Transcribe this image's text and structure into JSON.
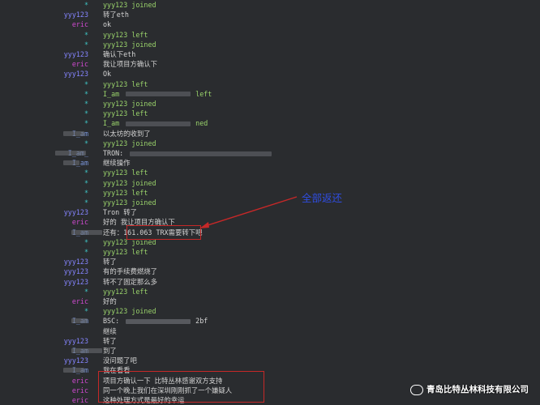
{
  "annotation": {
    "text": "全部返还"
  },
  "watermark": {
    "company": "青岛比特丛林科技有限公司",
    "icon": "wechat-icon"
  },
  "colors": {
    "background": "#2a2c2f",
    "highlight_box": "#c62828",
    "annotation": "#2f4de0"
  },
  "lines": [
    {
      "nick": "*",
      "kind": "sys",
      "text": "yyy123 joined"
    },
    {
      "nick": "yyy123",
      "kind": "yyy",
      "text": "转了eth"
    },
    {
      "nick": "eric",
      "kind": "eric",
      "text": "ok"
    },
    {
      "nick": "*",
      "kind": "sys",
      "text": "yyy123 left"
    },
    {
      "nick": "*",
      "kind": "sys",
      "text": "yyy123 joined"
    },
    {
      "nick": "yyy123",
      "kind": "yyy",
      "text": "确认下eth"
    },
    {
      "nick": "eric",
      "kind": "eric",
      "text": "我让项目方确认下"
    },
    {
      "nick": "yyy123",
      "kind": "yyy",
      "text": "Ok"
    },
    {
      "nick": "*",
      "kind": "sys",
      "text": "yyy123 left"
    },
    {
      "nick": "*",
      "kind": "sys",
      "text": "I_am",
      "tail": "left",
      "blur": true
    },
    {
      "nick": "*",
      "kind": "sys",
      "text": "yyy123 joined"
    },
    {
      "nick": "*",
      "kind": "sys",
      "text": "yyy123 left"
    },
    {
      "nick": "*",
      "kind": "sys",
      "text": "I_am",
      "tail": "ned",
      "blur": true
    },
    {
      "nick": "I_am",
      "kind": "iam",
      "text": "以太坊的收到了",
      "nblur": true
    },
    {
      "nick": "*",
      "kind": "sys",
      "text": "yyy123 joined"
    },
    {
      "nick": "I_am_",
      "kind": "iam",
      "text": "TRON:",
      "nblur": true,
      "blur": true
    },
    {
      "nick": "I_am",
      "kind": "iam",
      "text": "继续操作",
      "nblur": true
    },
    {
      "nick": "*",
      "kind": "sys",
      "text": "yyy123 left"
    },
    {
      "nick": "*",
      "kind": "sys",
      "text": "yyy123 joined"
    },
    {
      "nick": "*",
      "kind": "sys",
      "text": "yyy123 left"
    },
    {
      "nick": "*",
      "kind": "sys",
      "text": "yyy123 joined"
    },
    {
      "nick": "yyy123",
      "kind": "yyy",
      "text": "Tron 转了"
    },
    {
      "nick": "eric",
      "kind": "eric",
      "text": "好的 我让项目方确认下"
    },
    {
      "nick": "I_am",
      "kind": "iam",
      "text": "还有：161.063 TRX需要转下吧",
      "nblur": true
    },
    {
      "nick": "*",
      "kind": "sys",
      "text": "yyy123 joined"
    },
    {
      "nick": "*",
      "kind": "sys",
      "text": "yyy123 left"
    },
    {
      "nick": "yyy123",
      "kind": "yyy",
      "text": "转了"
    },
    {
      "nick": "yyy123",
      "kind": "yyy",
      "text": "有的手续费燃烧了"
    },
    {
      "nick": "yyy123",
      "kind": "yyy",
      "text": "转不了固定那么多"
    },
    {
      "nick": "*",
      "kind": "sys",
      "text": "yyy123 left"
    },
    {
      "nick": "eric",
      "kind": "eric",
      "text": "好的"
    },
    {
      "nick": "*",
      "kind": "sys",
      "text": "yyy123 joined"
    },
    {
      "nick": "I_am",
      "kind": "iam",
      "text": "BSC:",
      "tail": "2bf",
      "nblur": true,
      "blur": true
    },
    {
      "nick": "",
      "kind": "nor",
      "text": "继续"
    },
    {
      "nick": "yyy123",
      "kind": "yyy",
      "text": "转了"
    },
    {
      "nick": "I_am",
      "kind": "iam",
      "text": "到了",
      "nblur": true
    },
    {
      "nick": "yyy123",
      "kind": "yyy",
      "text": "没问题了吧"
    },
    {
      "nick": "I_am",
      "kind": "iam",
      "text": "我在看看",
      "nblur": true
    },
    {
      "nick": "eric",
      "kind": "eric",
      "text": "项目方确认一下 比特丛林感谢双方支持"
    },
    {
      "nick": "eric",
      "kind": "eric",
      "text": "同一个晚上我们在深圳刚刚抓了一个嫌疑人"
    },
    {
      "nick": "eric",
      "kind": "eric",
      "text": "这种处理方式是最好的幸运"
    }
  ]
}
